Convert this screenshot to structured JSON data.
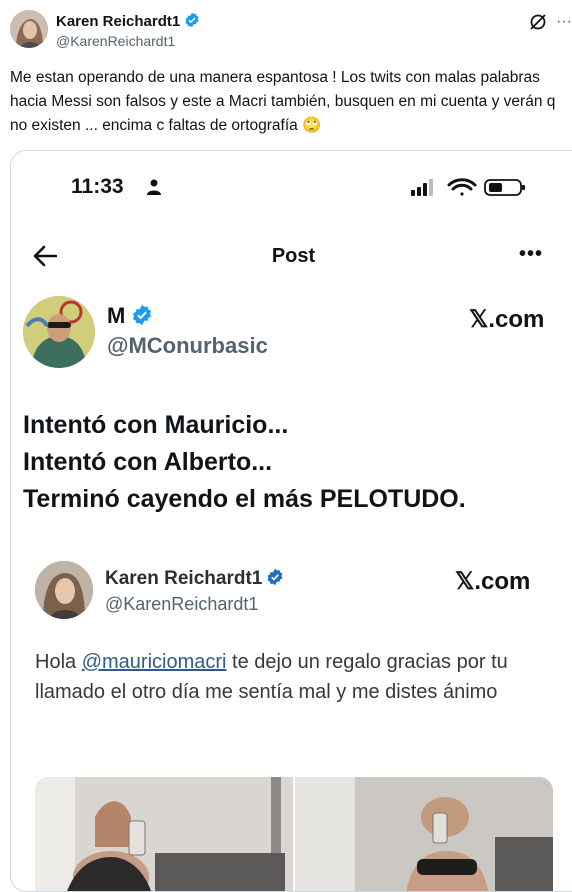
{
  "author": {
    "name": "Karen Reichardt1",
    "handle": "@KarenReichardt1",
    "text": "Me estan operando de una manera espantosa ! Los twits con malas palabras hacia Messi  son falsos y este a Macri también, busquen en mi cuenta y verán q no existen ... encima c faltas de ortografía 🙄"
  },
  "screenshot": {
    "status_time": "11:33",
    "page_title": "Post",
    "more": "•••",
    "account": {
      "name": "M",
      "handle": "@MConurbasic",
      "brand": "𝕏.com"
    },
    "lines": [
      "Intentó con Mauricio...",
      "Intentó con Alberto...",
      "Terminó cayendo el más PELOTUDO."
    ],
    "quoted": {
      "name": "Karen Reichardt1",
      "handle": "@KarenReichardt1",
      "brand": "𝕏.com",
      "text_before": "Hola ",
      "mention": "@mauriciomacri",
      "text_after": " te dejo un regalo gracias por tu llamado el otro día me sentía mal y me distes ánimo"
    }
  },
  "colors": {
    "verified_blue": "#1d9bf0",
    "link_blue": "#2f5b8a",
    "muted": "#536471"
  },
  "icons": [
    "verified-badge-icon",
    "grok-icon",
    "more-icon",
    "back-arrow-icon",
    "signal-icon",
    "wifi-icon",
    "battery-icon",
    "person-icon"
  ]
}
